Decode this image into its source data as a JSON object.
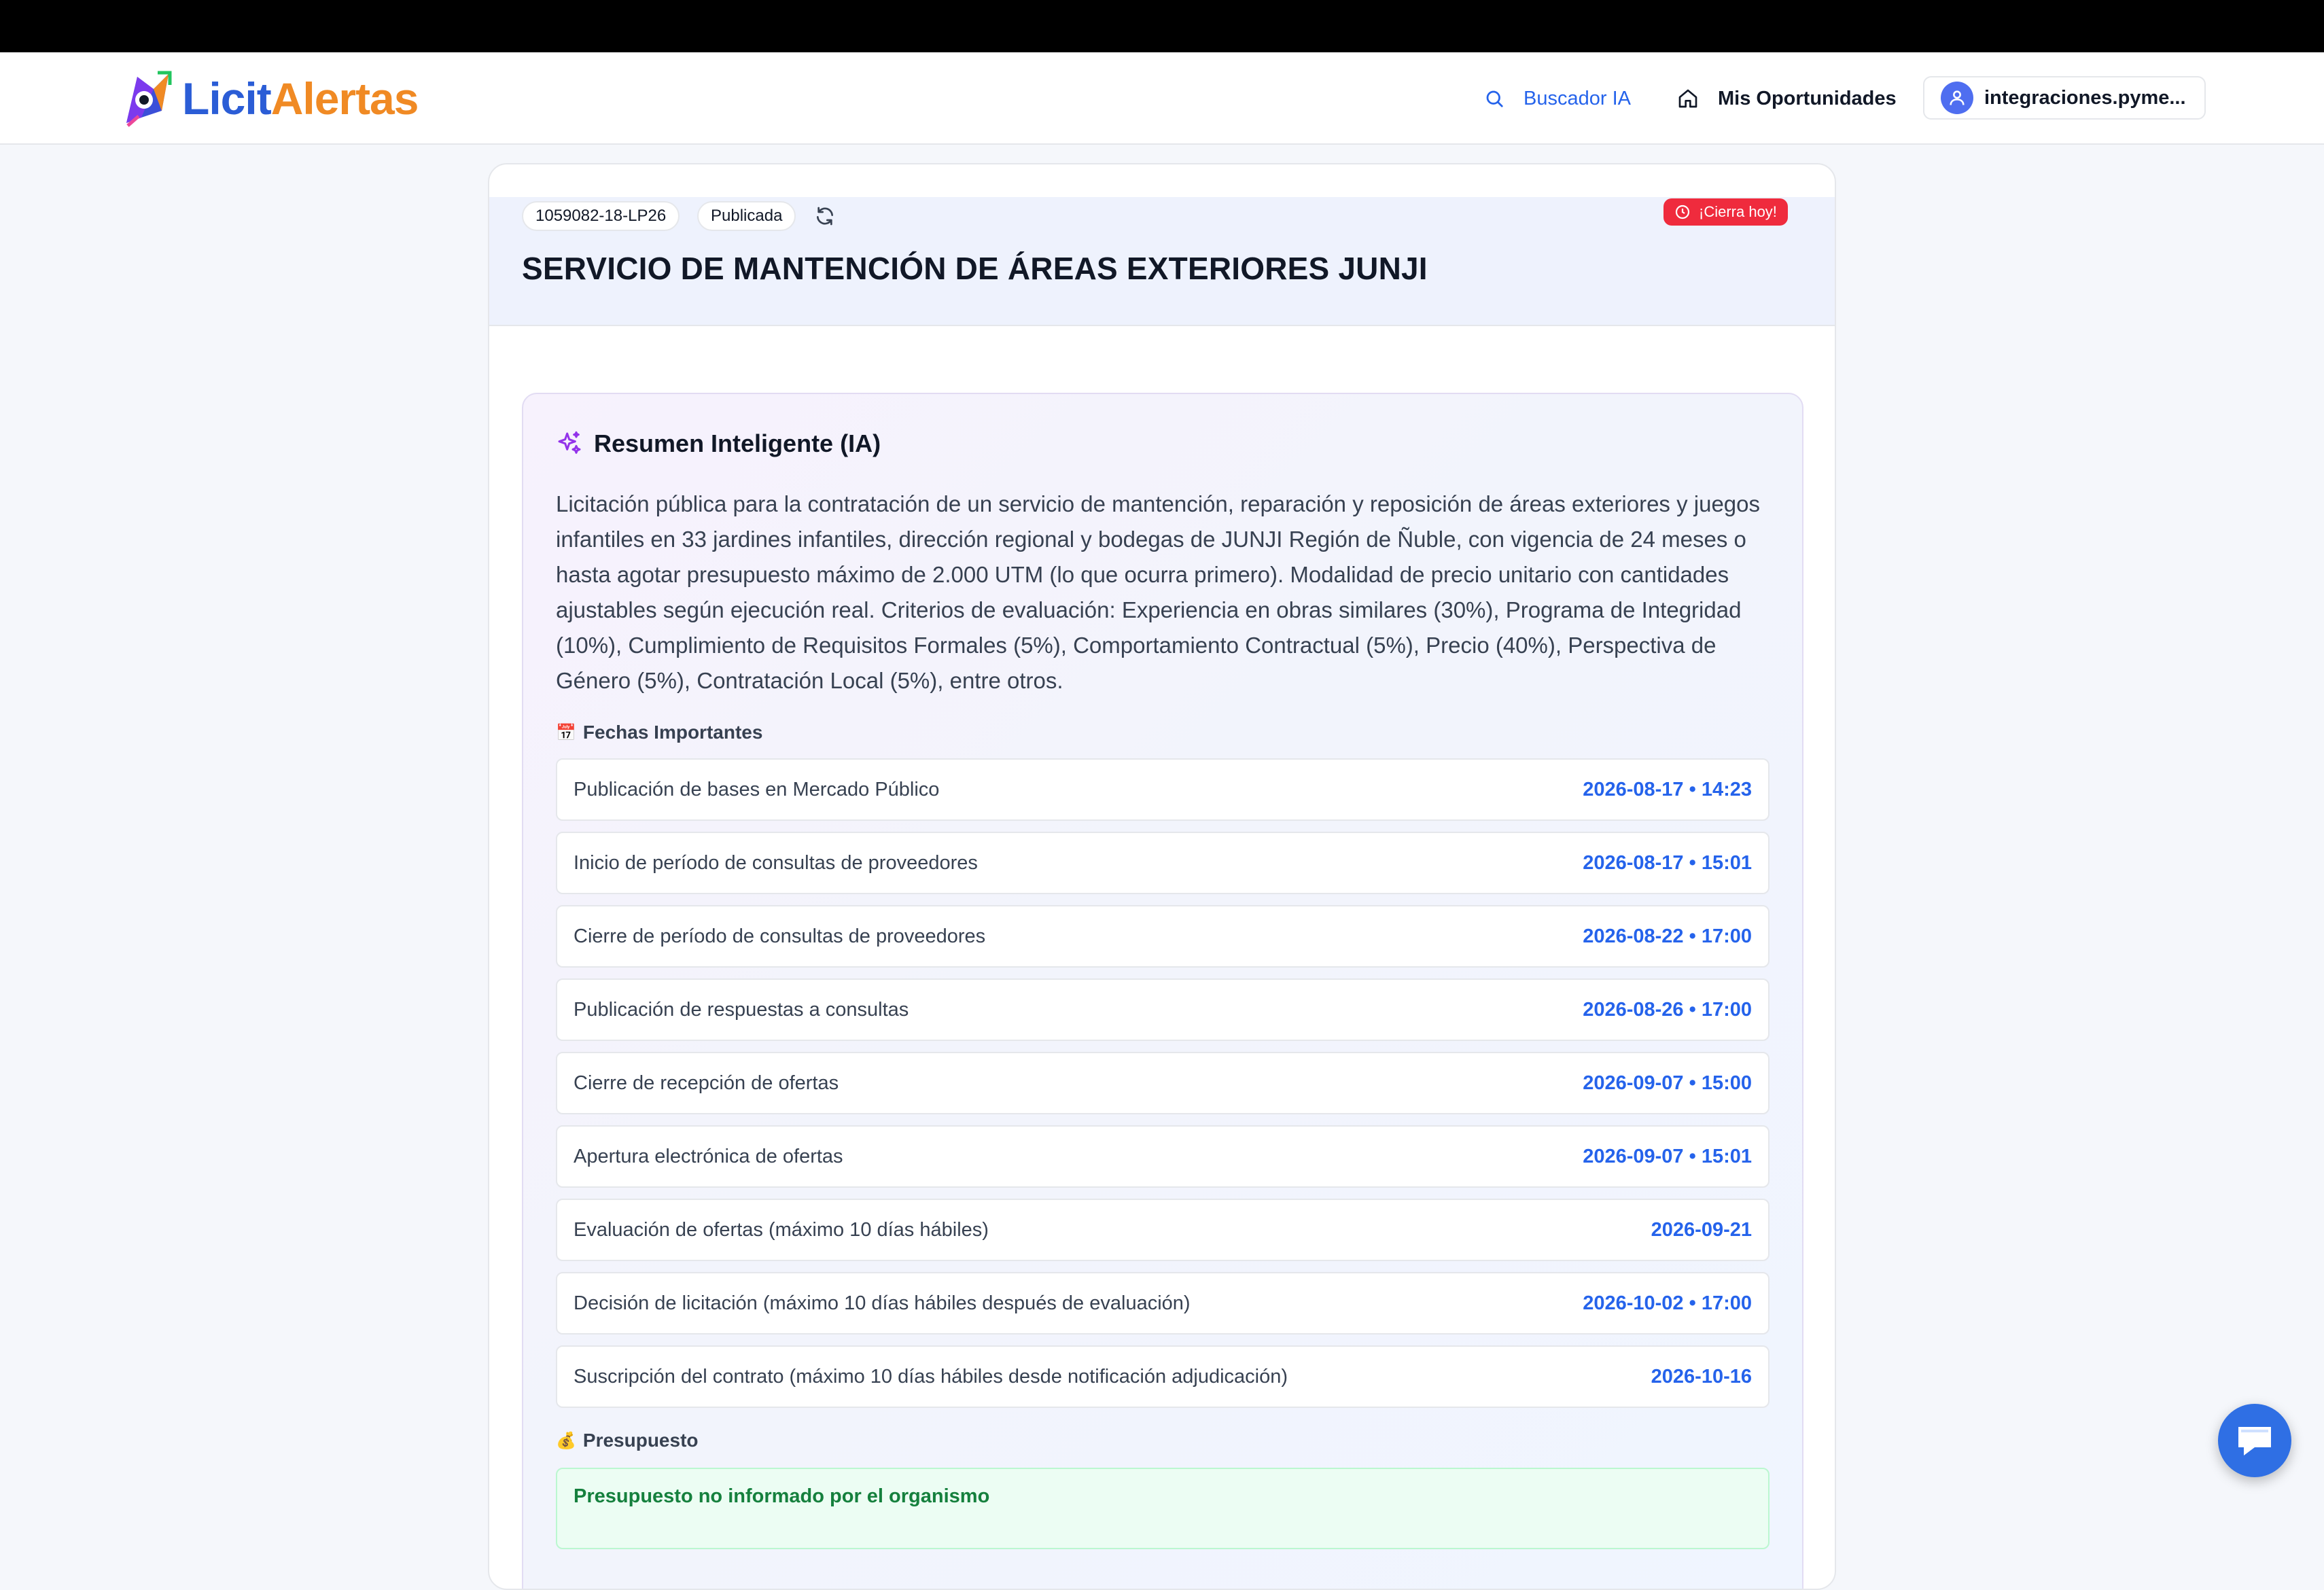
{
  "brand": {
    "part1": "Licit",
    "part2": "Alertas"
  },
  "nav": {
    "ai_search": "Buscador IA",
    "opportunities": "Mis Oportunidades",
    "user": "integraciones.pyme..."
  },
  "tender": {
    "id": "1059082-18-LP26",
    "status": "Publicada",
    "closing_badge": "¡Cierra hoy!",
    "title": "SERVICIO DE MANTENCIÓN DE ÁREAS EXTERIORES JUNJI"
  },
  "summary": {
    "title": "Resumen Inteligente (IA)",
    "text": "Licitación pública para la contratación de un servicio de mantención, reparación y reposición de áreas exteriores y juegos infantiles en 33 jardines infantiles, dirección regional y bodegas de JUNJI Región de Ñuble, con vigencia de 24 meses o hasta agotar presupuesto máximo de 2.000 UTM (lo que ocurra primero). Modalidad de precio unitario con cantidades ajustables según ejecución real. Criterios de evaluación: Experiencia en obras similares (30%), Programa de Integridad (10%), Cumplimiento de Requisitos Formales (5%), Comportamiento Contractual (5%), Precio (40%), Perspectiva de Género (5%), Contratación Local (5%), entre otros."
  },
  "dates_section": {
    "emoji": "📅",
    "label": "Fechas Importantes",
    "items": [
      {
        "label": "Publicación de bases en Mercado Público",
        "value": "2026-08-17 • 14:23"
      },
      {
        "label": "Inicio de período de consultas de proveedores",
        "value": "2026-08-17 • 15:01"
      },
      {
        "label": "Cierre de período de consultas de proveedores",
        "value": "2026-08-22 • 17:00"
      },
      {
        "label": "Publicación de respuestas a consultas",
        "value": "2026-08-26 • 17:00"
      },
      {
        "label": "Cierre de recepción de ofertas",
        "value": "2026-09-07 • 15:00"
      },
      {
        "label": "Apertura electrónica de ofertas",
        "value": "2026-09-07 • 15:01"
      },
      {
        "label": "Evaluación de ofertas (máximo 10 días hábiles)",
        "value": "2026-09-21"
      },
      {
        "label": "Decisión de licitación (máximo 10 días hábiles después de evaluación)",
        "value": "2026-10-02 • 17:00"
      },
      {
        "label": "Suscripción del contrato (máximo 10 días hábiles desde notificación adjudicación)",
        "value": "2026-10-16"
      }
    ]
  },
  "budget_section": {
    "emoji": "💰",
    "label": "Presupuesto",
    "note": "Presupuesto no informado por el organismo"
  }
}
